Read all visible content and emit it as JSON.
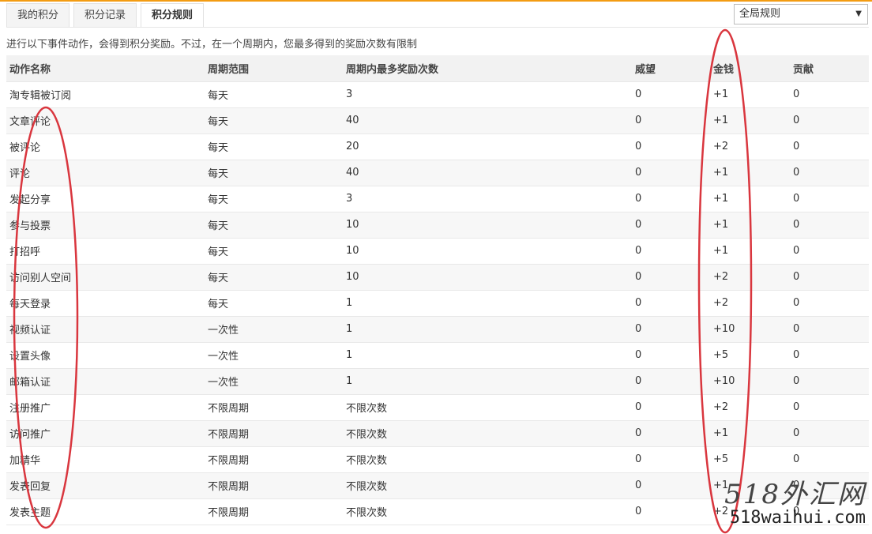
{
  "tabs": [
    {
      "label": "我的积分",
      "active": false
    },
    {
      "label": "积分记录",
      "active": false
    },
    {
      "label": "积分规则",
      "active": true
    }
  ],
  "filter": {
    "selected": "全局规则"
  },
  "description": "进行以下事件动作，会得到积分奖励。不过，在一个周期内，您最多得到的奖励次数有限制",
  "table": {
    "headers": [
      "动作名称",
      "周期范围",
      "周期内最多奖励次数",
      "威望",
      "金钱",
      "贡献"
    ],
    "rows": [
      [
        "淘专辑被订阅",
        "每天",
        "3",
        "0",
        "+1",
        "0"
      ],
      [
        "文章评论",
        "每天",
        "40",
        "0",
        "+1",
        "0"
      ],
      [
        "被评论",
        "每天",
        "20",
        "0",
        "+2",
        "0"
      ],
      [
        "评论",
        "每天",
        "40",
        "0",
        "+1",
        "0"
      ],
      [
        "发起分享",
        "每天",
        "3",
        "0",
        "+1",
        "0"
      ],
      [
        "参与投票",
        "每天",
        "10",
        "0",
        "+1",
        "0"
      ],
      [
        "打招呼",
        "每天",
        "10",
        "0",
        "+1",
        "0"
      ],
      [
        "访问别人空间",
        "每天",
        "10",
        "0",
        "+2",
        "0"
      ],
      [
        "每天登录",
        "每天",
        "1",
        "0",
        "+2",
        "0"
      ],
      [
        "视频认证",
        "一次性",
        "1",
        "0",
        "+10",
        "0"
      ],
      [
        "设置头像",
        "一次性",
        "1",
        "0",
        "+5",
        "0"
      ],
      [
        "邮箱认证",
        "一次性",
        "1",
        "0",
        "+10",
        "0"
      ],
      [
        "注册推广",
        "不限周期",
        "不限次数",
        "0",
        "+2",
        "0"
      ],
      [
        "访问推广",
        "不限周期",
        "不限次数",
        "0",
        "+1",
        "0"
      ],
      [
        "加精华",
        "不限周期",
        "不限次数",
        "0",
        "+5",
        "0"
      ],
      [
        "发表回复",
        "不限周期",
        "不限次数",
        "0",
        "+1",
        "0"
      ],
      [
        "发表主题",
        "不限周期",
        "不限次数",
        "0",
        "+2",
        "0"
      ]
    ]
  },
  "watermark": {
    "logo": "518外汇网",
    "domain": "518waihui.com"
  },
  "colors": {
    "accent": "#f39c12",
    "annotation": "#d9363e"
  }
}
